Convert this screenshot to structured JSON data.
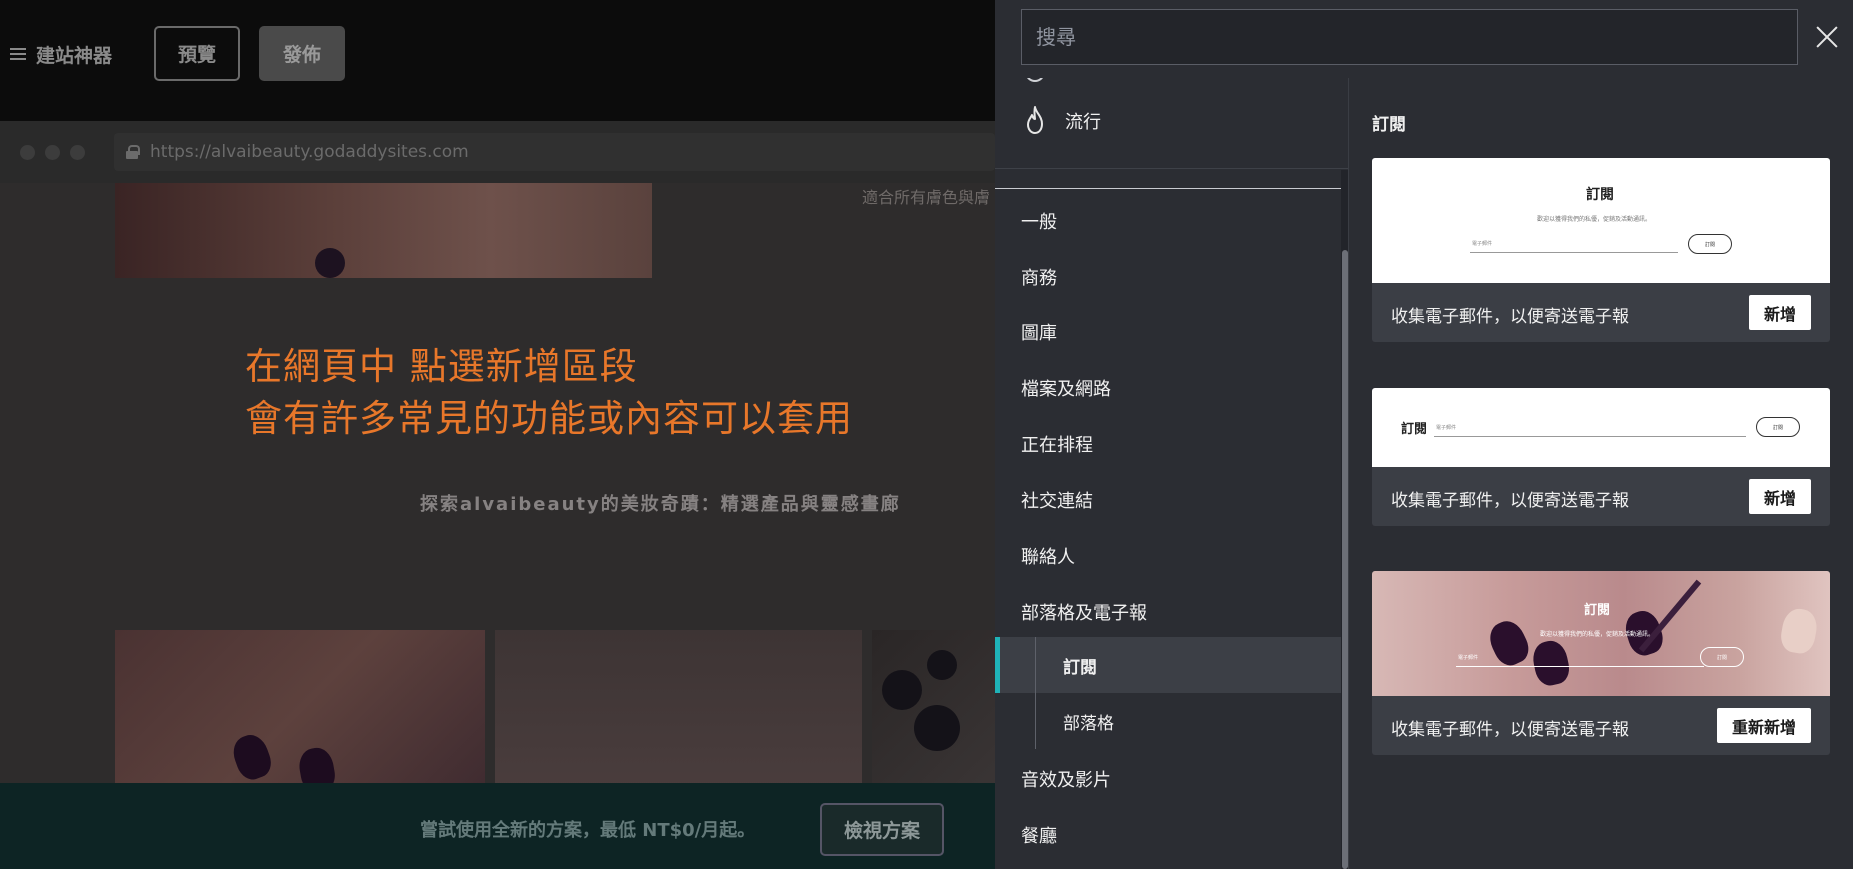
{
  "editor": {
    "brand": "建站神器",
    "preview_label": "預覽",
    "publish_label": "發佈",
    "url": "https://alvaibeauty.godaddysites.com",
    "side_note": "適合所有膚色與膚",
    "overlay_title_line1": "在網頁中 點選新增區段",
    "overlay_title_line2": "會有許多常見的功能或內容可以套用",
    "subtitle": "探索alvaibeauty的美妝奇蹟：精選產品與靈感畫廊",
    "promo_text": "嘗試使用全新的方案，最低 NT$0/月起。",
    "promo_button": "檢視方案"
  },
  "panel": {
    "search_placeholder": "搜尋",
    "popular_label": "流行",
    "categories": [
      {
        "label": "一般"
      },
      {
        "label": "商務"
      },
      {
        "label": "圖庫"
      },
      {
        "label": "檔案及網路"
      },
      {
        "label": "正在排程"
      },
      {
        "label": "社交連結"
      },
      {
        "label": "聯絡人"
      },
      {
        "label": "部落格及電子報"
      },
      {
        "label": "音效及影片"
      },
      {
        "label": "餐廳"
      }
    ],
    "subcategories": [
      {
        "label": "訂閱",
        "active": true
      },
      {
        "label": "部落格",
        "active": false
      }
    ],
    "section_title": "訂閱",
    "cards": [
      {
        "preview_title": "訂閱",
        "preview_subtitle": "歡迎以獲得我們的私優，促銷及活動通訊。",
        "preview_field": "電子郵件",
        "preview_button": "訂閱",
        "description": "收集電子郵件，以便寄送電子報",
        "button": "新增"
      },
      {
        "preview_title": "訂閱",
        "preview_field": "電子郵件",
        "preview_button": "訂閱",
        "description": "收集電子郵件，以便寄送電子報",
        "button": "新增"
      },
      {
        "preview_title": "訂閱",
        "preview_subtitle": "歡迎以獲得我們的私優，促銷及活動通訊。",
        "preview_field": "電子郵件",
        "preview_button": "訂閱",
        "description": "收集電子郵件，以便寄送電子報",
        "button": "重新新增"
      }
    ]
  },
  "colors": {
    "accent": "#1fb3b8",
    "overlay_text": "#e8772a",
    "panel_bg": "#2b2d33"
  },
  "icons": [
    "menu-icon",
    "lock-icon",
    "close-icon",
    "flame-icon"
  ]
}
